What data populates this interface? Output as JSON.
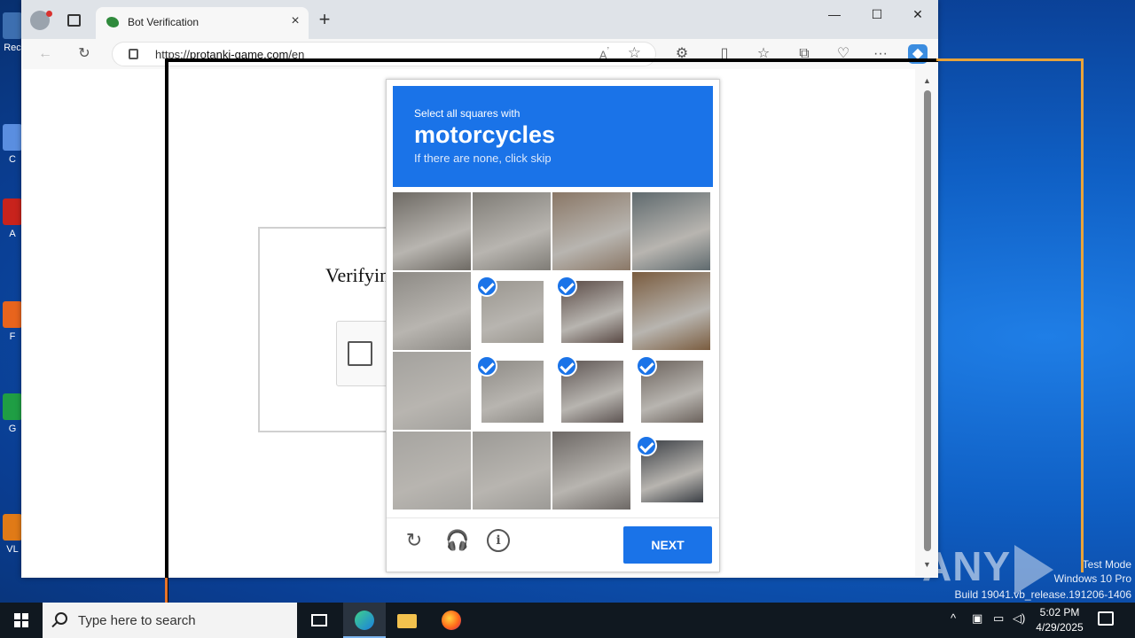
{
  "desktop": {
    "icons": [
      {
        "label": "Rec",
        "color": "#3d6fb0"
      },
      {
        "label": "C",
        "color": "#5a8ee0"
      },
      {
        "label": "A",
        "color": "#c8231c"
      },
      {
        "label": "F",
        "color": "#e8641d"
      },
      {
        "label": "G",
        "color": "#1f9e44"
      },
      {
        "label": "VL",
        "color": "#e07a17"
      }
    ],
    "watermark": {
      "line1": "Test Mode",
      "line2": "Windows 10 Pro",
      "line3": "Build 19041.vb_release.191206-1406"
    },
    "brand": "ANY.RUN"
  },
  "browser": {
    "tab_title": "Bot Verification",
    "url_prefix": "https://",
    "url_domain": "protanki-game.com",
    "url_path": "/en",
    "window_controls": {
      "minimize": "—",
      "maximize": "☐",
      "close": "✕"
    }
  },
  "page": {
    "verify_title": "Verifying you are human"
  },
  "captcha": {
    "instruction": "Select all squares with",
    "target": "motorcycles",
    "hint": "If there are none, click skip",
    "next_label": "NEXT",
    "tiles": [
      {
        "selected": false,
        "color": "#6e6a64"
      },
      {
        "selected": false,
        "color": "#7f7c76"
      },
      {
        "selected": false,
        "color": "#8a7766"
      },
      {
        "selected": false,
        "color": "#5f6a6e"
      },
      {
        "selected": false,
        "color": "#8d8a85"
      },
      {
        "selected": true,
        "color": "#9a968f"
      },
      {
        "selected": true,
        "color": "#5a4a45"
      },
      {
        "selected": false,
        "color": "#7a5c3f"
      },
      {
        "selected": false,
        "color": "#a3a19d"
      },
      {
        "selected": true,
        "color": "#8e8b86"
      },
      {
        "selected": true,
        "color": "#5e5553"
      },
      {
        "selected": true,
        "color": "#6b625c"
      },
      {
        "selected": false,
        "color": "#a6a4a0"
      },
      {
        "selected": false,
        "color": "#9c9a96"
      },
      {
        "selected": false,
        "color": "#6d6865"
      },
      {
        "selected": true,
        "color": "#3b3f45"
      }
    ]
  },
  "taskbar": {
    "search_placeholder": "Type here to search",
    "time": "5:02 PM",
    "date": "4/29/2025"
  }
}
